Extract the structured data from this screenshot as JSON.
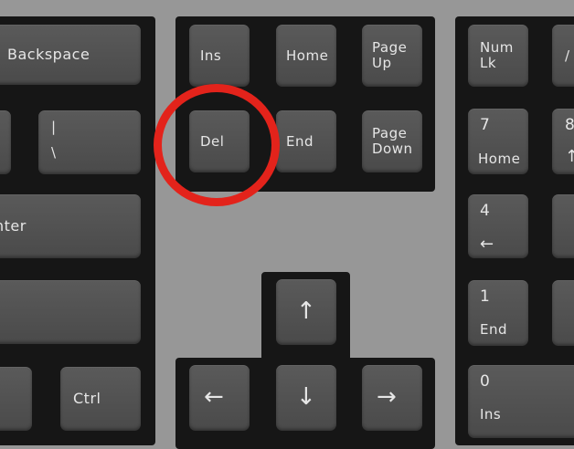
{
  "keys": {
    "backspace": "Backspace",
    "pipe_top": "|",
    "pipe_bottom": "\\",
    "enter": "nter",
    "ctrl": "Ctrl",
    "ins": "Ins",
    "home": "Home",
    "page_up": "Page\nUp",
    "del": "Del",
    "end": "End",
    "page_down": "Page\nDown",
    "num_lk": "Num\nLk",
    "slash": "/",
    "np7_num": "7",
    "np7_sub": "Home",
    "np8_num": "8",
    "np8_sub": "↑",
    "np4_num": "4",
    "np4_sub": "←",
    "np1_num": "1",
    "np1_sub": "End",
    "np0_num": "0",
    "np0_sub": "Ins",
    "arrow_up": "↑",
    "arrow_left": "←",
    "arrow_down": "↓",
    "arrow_right": "→"
  },
  "colors": {
    "highlight_circle": "#e3231b",
    "desk": "#979797",
    "key": "#4f4f4f",
    "plate": "#161616"
  }
}
